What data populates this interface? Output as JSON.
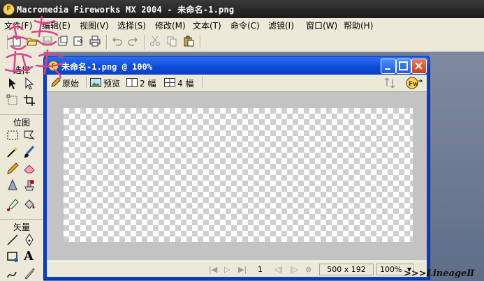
{
  "app": {
    "title": "Macromedia Fireworks MX 2004 - 未命名-1.png",
    "logo_icon": "fireworks-logo-icon"
  },
  "menu": [
    "文件(F)",
    "编辑(E)",
    "视图(V)",
    "选择(S)",
    "修改(M)",
    "文本(T)",
    "命令(C)",
    "滤镜(I)",
    "窗口(W)",
    "帮助(H)"
  ],
  "toolbar": {
    "icons": [
      "new-file-icon",
      "open-file-icon",
      "save-icon",
      "import-icon",
      "export-icon",
      "print-icon",
      "undo-icon",
      "redo-icon",
      "cut-icon",
      "copy-icon",
      "paste-icon"
    ]
  },
  "tools_panel": {
    "sections": [
      "选择",
      "位图",
      "矢量"
    ],
    "select_tools": [
      "pointer-tool-icon",
      "subselect-tool-icon",
      "scale-tool-icon",
      "crop-tool-icon"
    ],
    "bitmap_tools": [
      "marquee-tool-icon",
      "lasso-tool-icon",
      "magic-wand-tool-icon",
      "brush-tool-icon",
      "pencil-tool-icon",
      "eraser-tool-icon",
      "blur-tool-icon",
      "rubber-stamp-tool-icon",
      "eyedropper-tool-icon",
      "paint-bucket-tool-icon"
    ],
    "vector_tools": [
      "line-tool-icon",
      "pen-tool-icon",
      "rectangle-tool-icon",
      "text-tool-icon",
      "freeform-tool-icon",
      "knife-tool-icon"
    ]
  },
  "document": {
    "title": "未命名-1.png @ 100%",
    "view_tabs": [
      "原始",
      "预览",
      "2 幅",
      "4 幅"
    ],
    "frame_number": "1",
    "canvas_size": "500 x 192",
    "zoom": "100%"
  },
  "colors": {
    "titlebar_blue": "#0c4ad8",
    "panel_bg": "#ece9d8",
    "stamp_pink": "#e0408c"
  },
  "watermark": {
    "text": ">>>LineageⅡ"
  }
}
